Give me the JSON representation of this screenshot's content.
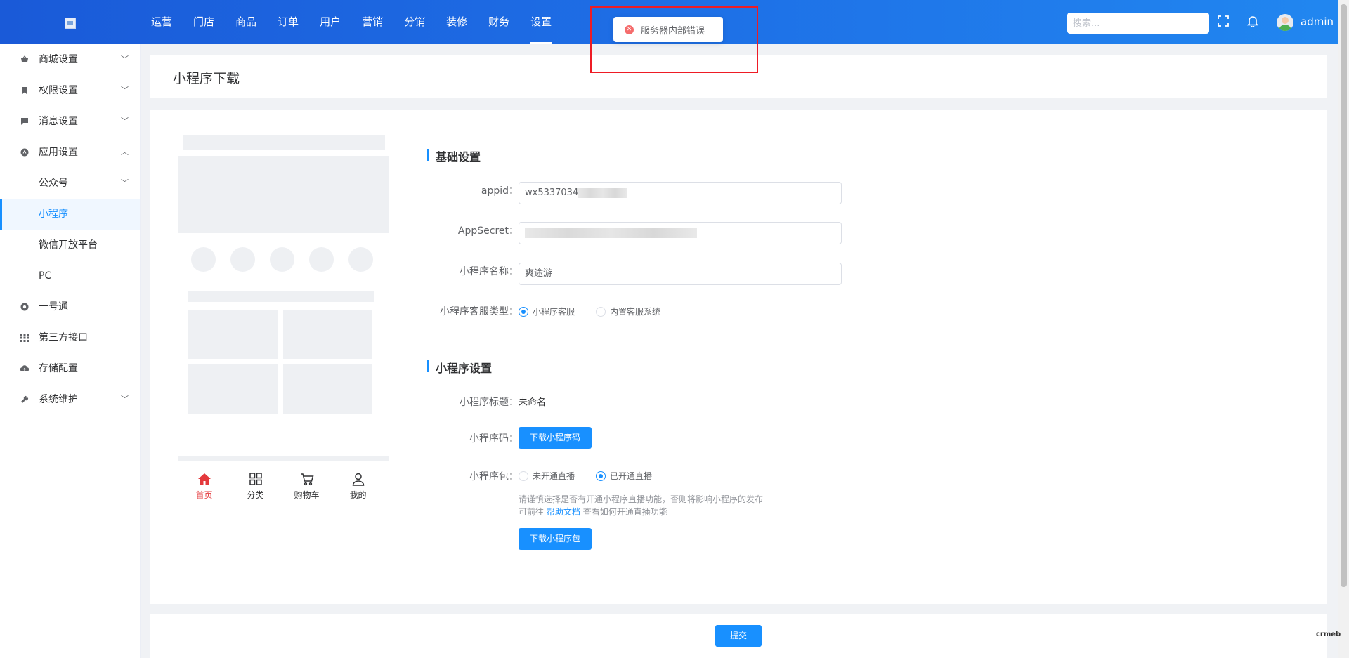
{
  "header": {
    "nav": [
      "运营",
      "门店",
      "商品",
      "订单",
      "用户",
      "营销",
      "分销",
      "装修",
      "财务",
      "设置"
    ],
    "active_nav": "设置",
    "search_placeholder": "搜索...",
    "username": "admin"
  },
  "toast": {
    "message": "服务器内部错误"
  },
  "sidebar": {
    "items": [
      {
        "label": "商城设置",
        "icon": "basket-icon",
        "chevron": "down"
      },
      {
        "label": "权限设置",
        "icon": "bookmark-icon",
        "chevron": "down"
      },
      {
        "label": "消息设置",
        "icon": "message-icon",
        "chevron": "down"
      },
      {
        "label": "应用设置",
        "icon": "app-icon",
        "chevron": "up"
      },
      {
        "label": "公众号",
        "icon": "",
        "chevron": "down",
        "sub": true
      },
      {
        "label": "小程序",
        "icon": "",
        "sub": true,
        "active": true
      },
      {
        "label": "微信开放平台",
        "icon": "",
        "sub": true
      },
      {
        "label": "PC",
        "icon": "",
        "sub": true
      },
      {
        "label": "一号通",
        "icon": "onepass-icon"
      },
      {
        "label": "第三方接口",
        "icon": "grid-icon"
      },
      {
        "label": "存储配置",
        "icon": "cloud-upload-icon"
      },
      {
        "label": "系统维护",
        "icon": "wrench-icon",
        "chevron": "down"
      }
    ]
  },
  "page": {
    "title": "小程序下载"
  },
  "preview": {
    "tabs": [
      {
        "label": "首页",
        "icon": "home-icon",
        "active": true
      },
      {
        "label": "分类",
        "icon": "category-icon"
      },
      {
        "label": "购物车",
        "icon": "cart-icon"
      },
      {
        "label": "我的",
        "icon": "user-icon"
      }
    ]
  },
  "form": {
    "basic_title": "基础设置",
    "appid_label": "appid：",
    "appid_value": "wx5337034",
    "appsecret_label": "AppSecret：",
    "name_label": "小程序名称：",
    "name_value": "爽途游",
    "service_label": "小程序客服类型：",
    "service_options": [
      "小程序客服",
      "内置客服系统"
    ],
    "service_selected": 0,
    "mini_title": "小程序设置",
    "mini_name_label": "小程序标题：",
    "mini_name_value": "未命名",
    "code_label": "小程序码：",
    "code_button": "下载小程序码",
    "package_label": "小程序包：",
    "package_options": [
      "未开通直播",
      "已开通直播"
    ],
    "package_selected": 1,
    "tip_line1": "请谨慎选择是否有开通小程序直播功能，否则将影响小程序的发布",
    "tip_prefix": "可前往",
    "tip_link": "帮助文档",
    "tip_suffix": "查看如何开通直播功能",
    "package_button": "下载小程序包"
  },
  "footer": {
    "submit": "提交"
  },
  "watermark": "crmeb"
}
